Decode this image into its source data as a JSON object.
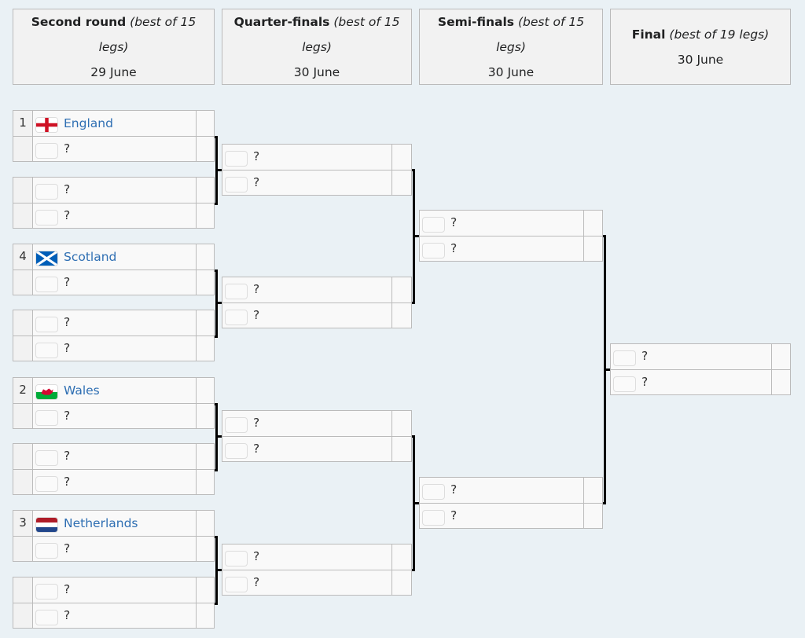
{
  "rounds": [
    {
      "name": "Second round",
      "format": "(best of 15 legs)",
      "date": "29 June"
    },
    {
      "name": "Quarter-finals",
      "format": "(best of 15 legs)",
      "date": "30 June"
    },
    {
      "name": "Semi-finals",
      "format": "(best of 15 legs)",
      "date": "30 June"
    },
    {
      "name": "Final",
      "format": "(best of 19 legs)",
      "date": "30 June"
    }
  ],
  "placeholder": "?",
  "second_round": [
    {
      "top": {
        "seed": "1",
        "team": "England",
        "flag": "england-flag"
      },
      "bottom": {
        "seed": "",
        "team": "?",
        "flag": "placeholder-flag"
      }
    },
    {
      "top": {
        "seed": "",
        "team": "?",
        "flag": "placeholder-flag"
      },
      "bottom": {
        "seed": "",
        "team": "?",
        "flag": "placeholder-flag"
      }
    },
    {
      "top": {
        "seed": "4",
        "team": "Scotland",
        "flag": "scotland-flag"
      },
      "bottom": {
        "seed": "",
        "team": "?",
        "flag": "placeholder-flag"
      }
    },
    {
      "top": {
        "seed": "",
        "team": "?",
        "flag": "placeholder-flag"
      },
      "bottom": {
        "seed": "",
        "team": "?",
        "flag": "placeholder-flag"
      }
    },
    {
      "top": {
        "seed": "2",
        "team": "Wales",
        "flag": "wales-flag"
      },
      "bottom": {
        "seed": "",
        "team": "?",
        "flag": "placeholder-flag"
      }
    },
    {
      "top": {
        "seed": "",
        "team": "?",
        "flag": "placeholder-flag"
      },
      "bottom": {
        "seed": "",
        "team": "?",
        "flag": "placeholder-flag"
      }
    },
    {
      "top": {
        "seed": "3",
        "team": "Netherlands",
        "flag": "netherlands-flag"
      },
      "bottom": {
        "seed": "",
        "team": "?",
        "flag": "placeholder-flag"
      }
    },
    {
      "top": {
        "seed": "",
        "team": "?",
        "flag": "placeholder-flag"
      },
      "bottom": {
        "seed": "",
        "team": "?",
        "flag": "placeholder-flag"
      }
    }
  ],
  "quarter_finals": [
    {
      "top": {
        "team": "?"
      },
      "bottom": {
        "team": "?"
      }
    },
    {
      "top": {
        "team": "?"
      },
      "bottom": {
        "team": "?"
      }
    },
    {
      "top": {
        "team": "?"
      },
      "bottom": {
        "team": "?"
      }
    },
    {
      "top": {
        "team": "?"
      },
      "bottom": {
        "team": "?"
      }
    }
  ],
  "semi_finals": [
    {
      "top": {
        "team": "?"
      },
      "bottom": {
        "team": "?"
      }
    },
    {
      "top": {
        "team": "?"
      },
      "bottom": {
        "team": "?"
      }
    }
  ],
  "final": [
    {
      "top": {
        "team": "?"
      },
      "bottom": {
        "team": "?"
      }
    }
  ],
  "colors": {
    "link": "#2f6fb3",
    "background": "#eaf1f5",
    "cell": "#f9f9f9",
    "header": "#f2f2f2",
    "border": "#bbbbbb"
  }
}
